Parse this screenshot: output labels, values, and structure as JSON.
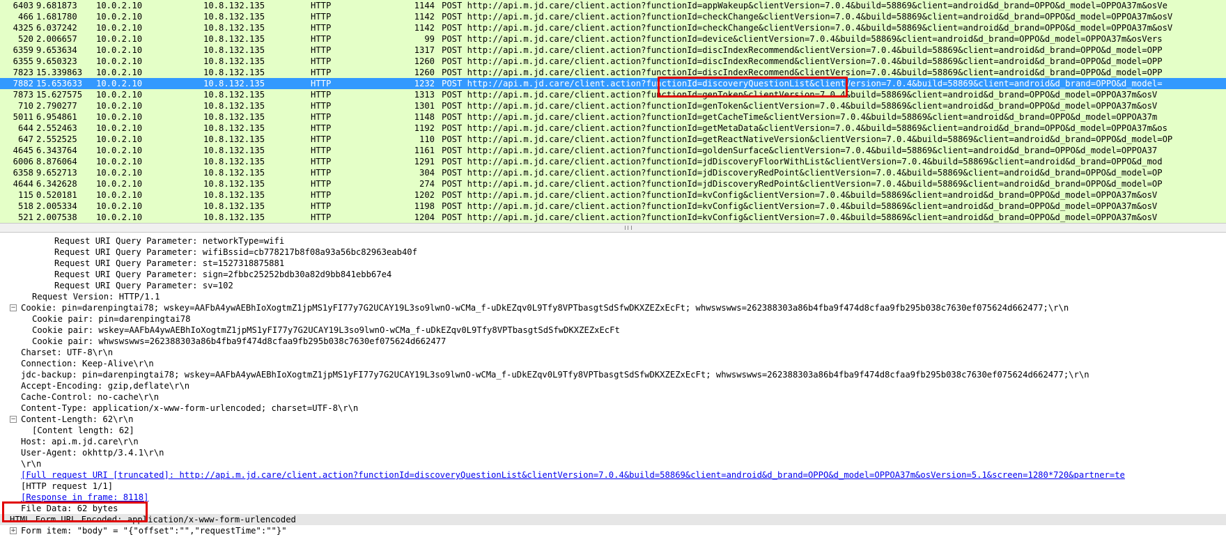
{
  "packet_list": {
    "rows": [
      {
        "no": "6403",
        "time": "9.681873",
        "src": "10.0.2.10",
        "dst": "10.8.132.135",
        "proto": "HTTP",
        "len": "1144",
        "info": "POST http://api.m.jd.care/client.action?functionId=appWakeup&clientVersion=7.0.4&build=58869&client=android&d_brand=OPPO&d_model=OPPOA37m&osVe"
      },
      {
        "no": "466",
        "time": "1.681780",
        "src": "10.0.2.10",
        "dst": "10.8.132.135",
        "proto": "HTTP",
        "len": "1142",
        "info": "POST http://api.m.jd.care/client.action?functionId=checkChange&clientVersion=7.0.4&build=58869&client=android&d_brand=OPPO&d_model=OPPOA37m&osV"
      },
      {
        "no": "4325",
        "time": "6.037242",
        "src": "10.0.2.10",
        "dst": "10.8.132.135",
        "proto": "HTTP",
        "len": "1142",
        "info": "POST http://api.m.jd.care/client.action?functionId=checkChange&clientVersion=7.0.4&build=58869&client=android&d_brand=OPPO&d_model=OPPOA37m&osV"
      },
      {
        "no": "520",
        "time": "2.006657",
        "src": "10.0.2.10",
        "dst": "10.8.132.135",
        "proto": "HTTP",
        "len": "99",
        "info": "POST http://api.m.jd.care/client.action?functionId=device&clientVersion=7.0.4&build=58869&client=android&d_brand=OPPO&d_model=OPPOA37m&osVers"
      },
      {
        "no": "6359",
        "time": "9.653634",
        "src": "10.0.2.10",
        "dst": "10.8.132.135",
        "proto": "HTTP",
        "len": "1317",
        "info": "POST http://api.m.jd.care/client.action?functionId=discIndexRecommend&clientVersion=7.0.4&build=58869&client=android&d_brand=OPPO&d_model=OPP"
      },
      {
        "no": "6355",
        "time": "9.650323",
        "src": "10.0.2.10",
        "dst": "10.8.132.135",
        "proto": "HTTP",
        "len": "1260",
        "info": "POST http://api.m.jd.care/client.action?functionId=discIndexRecommend&clientVersion=7.0.4&build=58869&client=android&d_brand=OPPO&d_model=OPP"
      },
      {
        "no": "7823",
        "time": "15.339863",
        "src": "10.0.2.10",
        "dst": "10.8.132.135",
        "proto": "HTTP",
        "len": "1260",
        "info": "POST http://api.m.jd.care/client.action?functionId=discIndexRecommend&clientVersion=7.0.4&build=58869&client=android&d_brand=OPPO&d_model=OPP"
      },
      {
        "no": "7882",
        "time": "15.653633",
        "src": "10.0.2.10",
        "dst": "10.8.132.135",
        "proto": "HTTP",
        "len": "1232",
        "info": "POST http://api.m.jd.care/client.action?functionId=discoveryQuestionList&clientVersion=7.0.4&build=58869&client=android&d_brand=OPPO&d_model=",
        "selected": true
      },
      {
        "no": "7873",
        "time": "15.627575",
        "src": "10.0.2.10",
        "dst": "10.8.132.135",
        "proto": "HTTP",
        "len": "1313",
        "info": "POST http://api.m.jd.care/client.action?functionId=genToken&clientVersion=7.0.4&build=58869&client=android&d_brand=OPPO&d_model=OPPOA37m&osV"
      },
      {
        "no": "710",
        "time": "2.790277",
        "src": "10.0.2.10",
        "dst": "10.8.132.135",
        "proto": "HTTP",
        "len": "1301",
        "info": "POST http://api.m.jd.care/client.action?functionId=genToken&clientVersion=7.0.4&build=58869&client=android&d_brand=OPPO&d_model=OPPOA37m&osV"
      },
      {
        "no": "5011",
        "time": "6.954861",
        "src": "10.0.2.10",
        "dst": "10.8.132.135",
        "proto": "HTTP",
        "len": "1148",
        "info": "POST http://api.m.jd.care/client.action?functionId=getCacheTime&clientVersion=7.0.4&build=58869&client=android&d_brand=OPPO&d_model=OPPOA37m"
      },
      {
        "no": "644",
        "time": "2.552463",
        "src": "10.0.2.10",
        "dst": "10.8.132.135",
        "proto": "HTTP",
        "len": "1192",
        "info": "POST http://api.m.jd.care/client.action?functionId=getMetaData&clientVersion=7.0.4&build=58869&client=android&d_brand=OPPO&d_model=OPPOA37m&os"
      },
      {
        "no": "647",
        "time": "2.552525",
        "src": "10.0.2.10",
        "dst": "10.8.132.135",
        "proto": "HTTP",
        "len": "110",
        "info": "POST http://api.m.jd.care/client.action?functionId=getReactNativeVersion&clientVersion=7.0.4&build=58869&client=android&d_brand=OPPO&d_model=OP"
      },
      {
        "no": "4645",
        "time": "6.343764",
        "src": "10.0.2.10",
        "dst": "10.8.132.135",
        "proto": "HTTP",
        "len": "1161",
        "info": "POST http://api.m.jd.care/client.action?functionId=goldenSurface&clientVersion=7.0.4&build=58869&client=android&d_brand=OPPO&d_model=OPPOA37"
      },
      {
        "no": "6006",
        "time": "8.876064",
        "src": "10.0.2.10",
        "dst": "10.8.132.135",
        "proto": "HTTP",
        "len": "1291",
        "info": "POST http://api.m.jd.care/client.action?functionId=jdDiscoveryFloorWithList&clientVersion=7.0.4&build=58869&client=android&d_brand=OPPO&d_mod"
      },
      {
        "no": "6358",
        "time": "9.652713",
        "src": "10.0.2.10",
        "dst": "10.8.132.135",
        "proto": "HTTP",
        "len": "304",
        "info": "POST http://api.m.jd.care/client.action?functionId=jdDiscoveryRedPoint&clientVersion=7.0.4&build=58869&client=android&d_brand=OPPO&d_model=OP"
      },
      {
        "no": "4644",
        "time": "6.342628",
        "src": "10.0.2.10",
        "dst": "10.8.132.135",
        "proto": "HTTP",
        "len": "274",
        "info": "POST http://api.m.jd.care/client.action?functionId=jdDiscoveryRedPoint&clientVersion=7.0.4&build=58869&client=android&d_brand=OPPO&d_model=OP"
      },
      {
        "no": "115",
        "time": "0.520181",
        "src": "10.0.2.10",
        "dst": "10.8.132.135",
        "proto": "HTTP",
        "len": "1202",
        "info": "POST http://api.m.jd.care/client.action?functionId=kvConfig&clientVersion=7.0.4&build=58869&client=android&d_brand=OPPO&d_model=OPPOA37m&osV"
      },
      {
        "no": "518",
        "time": "2.005334",
        "src": "10.0.2.10",
        "dst": "10.8.132.135",
        "proto": "HTTP",
        "len": "1198",
        "info": "POST http://api.m.jd.care/client.action?functionId=kvConfig&clientVersion=7.0.4&build=58869&client=android&d_brand=OPPO&d_model=OPPOA37m&osV"
      },
      {
        "no": "521",
        "time": "2.007538",
        "src": "10.0.2.10",
        "dst": "10.8.132.135",
        "proto": "HTTP",
        "len": "1204",
        "info": "POST http://api.m.jd.care/client.action?functionId=kvConfig&clientVersion=7.0.4&build=58869&client=android&d_brand=OPPO&d_model=OPPOA37m&osV"
      }
    ]
  },
  "details": {
    "rows": [
      {
        "indent": 4,
        "text": "Request URI Query Parameter: networkType=wifi"
      },
      {
        "indent": 4,
        "text": "Request URI Query Parameter: wifiBssid=cb778217b8f08a93a56bc82963eab40f"
      },
      {
        "indent": 4,
        "text": "Request URI Query Parameter: st=1527318875881"
      },
      {
        "indent": 4,
        "text": "Request URI Query Parameter: sign=2fbbc25252bdb30a82d9bb841ebb67e4"
      },
      {
        "indent": 4,
        "text": "Request URI Query Parameter: sv=102"
      },
      {
        "indent": 2,
        "text": "Request Version: HTTP/1.1"
      },
      {
        "indent": 1,
        "expander": "−",
        "text": "Cookie: pin=darenpingtai78; wskey=AAFbA4ywAEBhIoXogtmZ1jpMS1yFI77y7G2UCAY19L3so9lwnO-wCMa_f-uDkEZqv0L9Tfy8VPTbasgtSdSfwDKXZEZxEcFt; whwswswws=262388303a86b4fba9f474d8cfaa9fb295b038c7630ef075624d662477;\\r\\n"
      },
      {
        "indent": 2,
        "text": "Cookie pair: pin=darenpingtai78"
      },
      {
        "indent": 2,
        "text": "Cookie pair: wskey=AAFbA4ywAEBhIoXogtmZ1jpMS1yFI77y7G2UCAY19L3so9lwnO-wCMa_f-uDkEZqv0L9Tfy8VPTbasgtSdSfwDKXZEZxEcFt"
      },
      {
        "indent": 2,
        "text": "Cookie pair: whwswswws=262388303a86b4fba9f474d8cfaa9fb295b038c7630ef075624d662477"
      },
      {
        "indent": 1,
        "text": "Charset: UTF-8\\r\\n"
      },
      {
        "indent": 1,
        "text": "Connection: Keep-Alive\\r\\n"
      },
      {
        "indent": 1,
        "text": "jdc-backup: pin=darenpingtai78; wskey=AAFbA4ywAEBhIoXogtmZ1jpMS1yFI77y7G2UCAY19L3so9lwnO-wCMa_f-uDkEZqv0L9Tfy8VPTbasgtSdSfwDKXZEZxEcFt; whwswswws=262388303a86b4fba9f474d8cfaa9fb295b038c7630ef075624d662477;\\r\\n"
      },
      {
        "indent": 1,
        "text": "Accept-Encoding: gzip,deflate\\r\\n"
      },
      {
        "indent": 1,
        "text": "Cache-Control: no-cache\\r\\n"
      },
      {
        "indent": 1,
        "text": "Content-Type: application/x-www-form-urlencoded; charset=UTF-8\\r\\n"
      },
      {
        "indent": 1,
        "expander": "−",
        "text": "Content-Length: 62\\r\\n"
      },
      {
        "indent": 2,
        "text": "[Content length: 62]"
      },
      {
        "indent": 1,
        "text": "Host: api.m.jd.care\\r\\n"
      },
      {
        "indent": 1,
        "text": "User-Agent: okhttp/3.4.1\\r\\n"
      },
      {
        "indent": 1,
        "text": "\\r\\n"
      },
      {
        "indent": 1,
        "link": true,
        "text": "[Full request URI [truncated]: http://api.m.jd.care/client.action?functionId=discoveryQuestionList&clientVersion=7.0.4&build=58869&client=android&d_brand=OPPO&d_model=OPPOA37m&osVersion=5.1&screen=1280*720&partner=te"
      },
      {
        "indent": 1,
        "text": "[HTTP request 1/1]"
      },
      {
        "indent": 1,
        "link": true,
        "text": "[Response in frame: 8118]"
      },
      {
        "indent": 1,
        "text": "File Data: 62 bytes"
      },
      {
        "indent": 0,
        "gray": true,
        "text": "HTML Form URL Encoded: application/x-www-form-urlencoded"
      },
      {
        "indent": 1,
        "expander": "+",
        "text": "Form item: \"body\" = \"{\"offset\":\"\",\"requestTime\":\"\"}\""
      }
    ]
  },
  "colors": {
    "http_row_bg": "#e4ffc7",
    "selected_row_bg": "#3399ff",
    "annotation_red": "#e00000",
    "link": "#0000ee"
  }
}
